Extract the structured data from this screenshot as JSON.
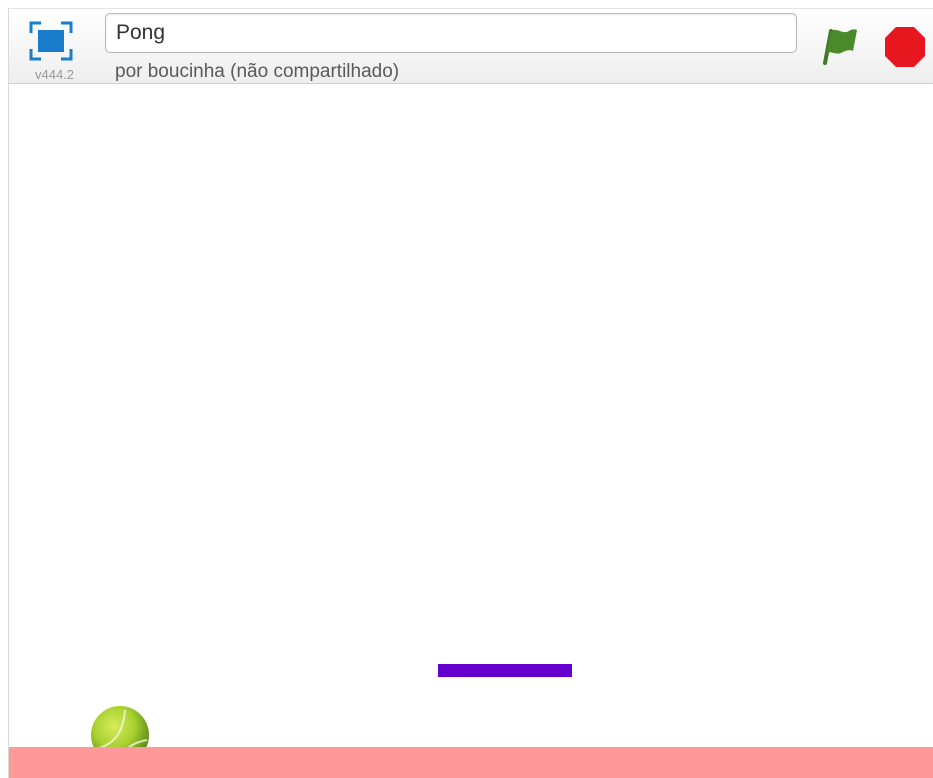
{
  "header": {
    "project_title": "Pong",
    "author_line": "por boucinha (não compartilhado)",
    "version": "v444.2",
    "fullscreen_icon": "fullscreen-icon",
    "green_flag_icon": "green-flag-icon",
    "stop_icon": "stop-sign-icon"
  },
  "stage": {
    "sprites": [
      {
        "name": "paddle",
        "color": "#6600cc"
      },
      {
        "name": "tennis-ball",
        "color": "#a8d030"
      }
    ],
    "floor_color": "#ff9999",
    "background_color": "#ffffff"
  },
  "colors": {
    "flag_green": "#4a8a2a",
    "stop_red": "#e8171f",
    "fullscreen_blue": "#1a7ccc"
  }
}
